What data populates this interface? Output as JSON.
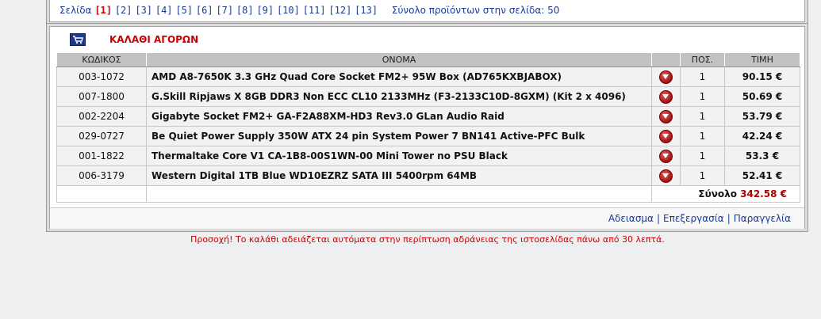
{
  "pager": {
    "label": "Σελίδα",
    "current": "[1]",
    "pages": [
      "[2]",
      "[3]",
      "[4]",
      "[5]",
      "[6]",
      "[7]",
      "[8]",
      "[9]",
      "[10]",
      "[11]",
      "[12]",
      "[13]"
    ],
    "products_per_page": "Σύνολο προϊόντων στην σελίδα: 50"
  },
  "cart": {
    "title": "ΚΑΛΑΘΙ ΑΓΟΡΩΝ",
    "icon": "cart-icon",
    "columns": {
      "code": "ΚΩΔΙΚΟΣ",
      "name": "ΟΝΟΜΑ",
      "qty": "ΠΟΣ.",
      "price": "ΤΙΜΗ"
    },
    "items": [
      {
        "code": "003-1072",
        "name": "AMD A8-7650K 3.3 GHz Quad Core Socket FM2+ 95W Box (AD765KXBJABOX)",
        "qty": "1",
        "price": "90.15 €"
      },
      {
        "code": "007-1800",
        "name": "G.Skill Ripjaws X 8GB DDR3 Non ECC CL10 2133MHz (F3-2133C10D-8GXM) (Kit 2 x 4096)",
        "qty": "1",
        "price": "50.69 €"
      },
      {
        "code": "002-2204",
        "name": "Gigabyte Socket FM2+ GA-F2A88XM-HD3 Rev3.0 GLan Audio Raid",
        "qty": "1",
        "price": "53.79 €"
      },
      {
        "code": "029-0727",
        "name": "Be Quiet Power Supply 350W ATX 24 pin System Power 7 BN141 Active-PFC Bulk",
        "qty": "1",
        "price": "42.24 €"
      },
      {
        "code": "001-1822",
        "name": "Thermaltake Core V1 CA-1B8-00S1WN-00 Mini Tower no PSU Black",
        "qty": "1",
        "price": "53.3 €"
      },
      {
        "code": "006-3179",
        "name": "Western Digital 1TB Blue WD10EZRZ SATA III 5400rpm 64MB",
        "qty": "1",
        "price": "52.41 €"
      }
    ],
    "total_label": "Σύνολο",
    "total_value": "342.58 €",
    "actions": {
      "empty": "Αδειασμα",
      "edit": "Επεξεργασία",
      "order": "Παραγγελία"
    },
    "separator": "|"
  },
  "warning": "Προσοχή! Το καλάθι αδειάζεται αυτόματα στην περίπτωση αδράνειας της ιστοσελίδας πάνω από 30 λεπτά.",
  "colors": {
    "accent_red": "#cc0000",
    "link_blue": "#1a3a9a",
    "header_gray": "#c2c2c2"
  }
}
